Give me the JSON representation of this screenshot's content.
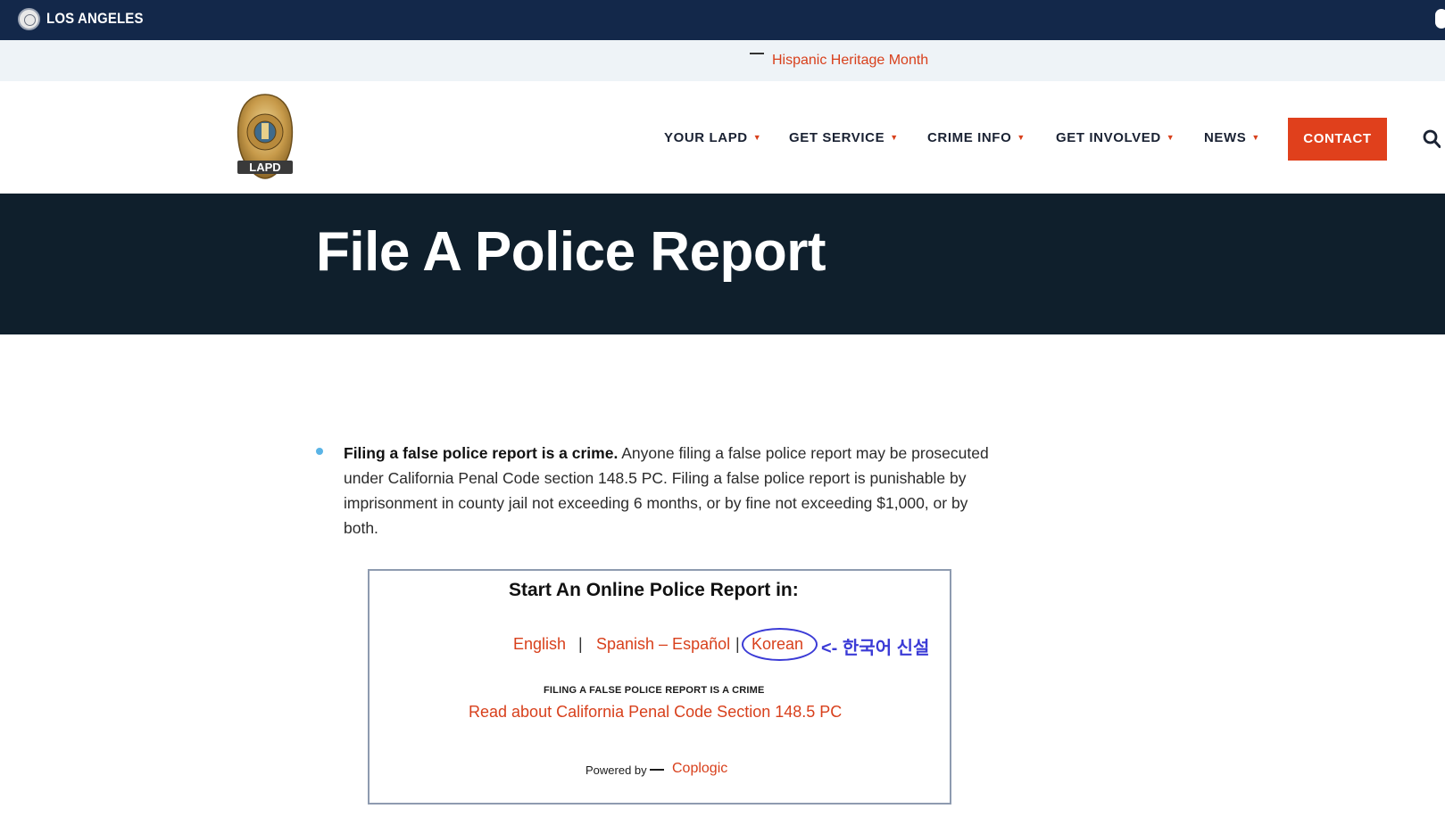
{
  "topbar": {
    "city": "LOS ANGELES"
  },
  "alert": {
    "link": "Hispanic Heritage Month"
  },
  "logo": {
    "text": "LAPD"
  },
  "nav": {
    "items": [
      {
        "label": "YOUR LAPD"
      },
      {
        "label": "GET SERVICE"
      },
      {
        "label": "CRIME INFO"
      },
      {
        "label": "GET INVOLVED"
      },
      {
        "label": "NEWS"
      }
    ],
    "caret": "▼",
    "contact": "CONTACT"
  },
  "hero": {
    "title": "File A Police Report"
  },
  "notice": {
    "bold": "Filing a false police report is a crime.",
    "text": " Anyone filing a false police report may be prosecuted under California Penal Code section 148.5 PC. Filing a false police report is punishable by imprisonment in county jail not exceeding 6 months, or by fine not exceeding $1,000, or by both."
  },
  "report_box": {
    "title": "Start An Online Police Report in:",
    "languages": [
      "English",
      "Spanish – Español",
      "Korean"
    ],
    "separator": "|",
    "annotation": "<- 한국어 신설",
    "false_caps": "FILING A FALSE POLICE REPORT IS A CRIME",
    "penal_link": "Read about California Penal Code Section 148.5 PC",
    "powered_by": "Powered by",
    "vendor": "Coplogic"
  },
  "colors": {
    "topbar": "#13284a",
    "accent": "#d8401c",
    "hero": "#0f1f2c",
    "annotation": "#3b3bd6"
  },
  "icons": {
    "search": "search-icon",
    "seal": "city-seal-icon",
    "badge": "lapd-badge-logo"
  }
}
